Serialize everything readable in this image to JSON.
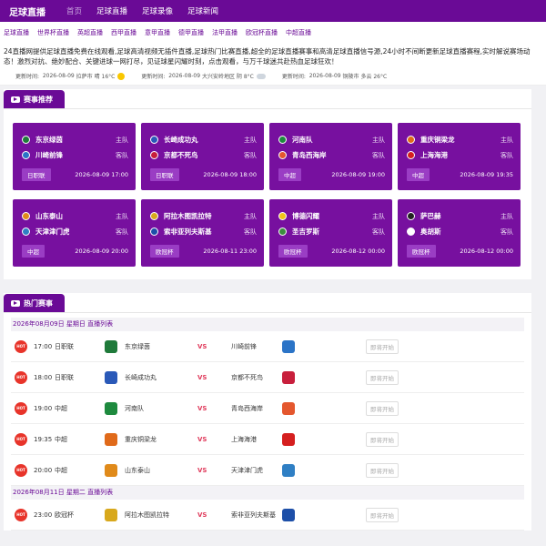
{
  "header": {
    "logo": "足球直播",
    "nav": [
      "首页",
      "足球直播",
      "足球录像",
      "足球新闻"
    ]
  },
  "subnav": [
    "足球直播",
    "世界杯直播",
    "英超直播",
    "西甲直播",
    "意甲直播",
    "德甲直播",
    "法甲直播",
    "欧冠杯直播",
    "中超直播"
  ],
  "intro": "24直播网提供足球直播免费在线观看,足球高清视频无插件直播,足球热门比赛直播,超全的足球直播赛事和高清足球直播信号源,24小时不间断更新足球直播赛程,实时解说赛场动态！激烈对抗、绝妙配合、关键进球一网打尽，见证球星闪耀时刻，点击观看，与万千球迷共赴热血足球狂欢！",
  "weather": [
    {
      "label": "更新时间:",
      "date": "2026-08-09",
      "place": "拉萨市",
      "cond": "晴 16°C",
      "icon": "sun-icon"
    },
    {
      "label": "更新时间:",
      "date": "2026-08-09",
      "place": "大兴安岭地区",
      "cond": "阴 8°C",
      "icon": "cloud-icon"
    },
    {
      "label": "更新时间:",
      "date": "2026-08-09",
      "place": "铜陵市",
      "cond": "多云 26°C",
      "icon": ""
    }
  ],
  "recommend": {
    "title": "赛事推荐",
    "home_label": "主队",
    "away_label": "客队",
    "cards": [
      {
        "home": "东京绿茵",
        "away": "川崎前锋",
        "league": "日职联",
        "time": "2026-08-09 17:00",
        "hc": "#1f7a3a",
        "ac": "#2b74c7"
      },
      {
        "home": "长崎成功丸",
        "away": "京都不死鸟",
        "league": "日职联",
        "time": "2026-08-09 18:00",
        "hc": "#2a59b8",
        "ac": "#c81f3c"
      },
      {
        "home": "河南队",
        "away": "青岛西海岸",
        "league": "中超",
        "time": "2026-08-09 19:00",
        "hc": "#1e8a3e",
        "ac": "#e4572e"
      },
      {
        "home": "重庆铜梁龙",
        "away": "上海海港",
        "league": "中超",
        "time": "2026-08-09 19:35",
        "hc": "#e06a1a",
        "ac": "#d51f1f"
      },
      {
        "home": "山东泰山",
        "away": "天津津门虎",
        "league": "中超",
        "time": "2026-08-09 20:00",
        "hc": "#e08a1a",
        "ac": "#2f7fc4"
      },
      {
        "home": "阿拉木图凯拉特",
        "away": "索非亚列夫斯基",
        "league": "欧冠杯",
        "time": "2026-08-11 23:00",
        "hc": "#d8a81c",
        "ac": "#1d4fa8"
      },
      {
        "home": "博德闪耀",
        "away": "圣吉罗斯",
        "league": "欧冠杯",
        "time": "2026-08-12 00:00",
        "hc": "#f0c419",
        "ac": "#3c8d3f"
      },
      {
        "home": "萨巴赫",
        "away": "奥胡斯",
        "league": "欧冠杯",
        "time": "2026-08-12 00:00",
        "hc": "#222222",
        "ac": "#ffffff"
      }
    ]
  },
  "hot": {
    "title": "热门赛事",
    "days": [
      {
        "date": "2026年08月09日 星期日 直播列表",
        "matches": [
          {
            "time": "17:00",
            "league": "日职联",
            "home": "东京绿茵",
            "away": "川崎前锋",
            "vs": "VS",
            "btn": "即将开始",
            "hc": "#1f7a3a",
            "ac": "#2b74c7"
          },
          {
            "time": "18:00",
            "league": "日职联",
            "home": "长崎成功丸",
            "away": "京都不死鸟",
            "vs": "VS",
            "btn": "即将开始",
            "hc": "#2a59b8",
            "ac": "#c81f3c"
          },
          {
            "time": "19:00",
            "league": "中超",
            "home": "河南队",
            "away": "青岛西海岸",
            "vs": "VS",
            "btn": "即将开始",
            "hc": "#1e8a3e",
            "ac": "#e4572e"
          },
          {
            "time": "19:35",
            "league": "中超",
            "home": "重庆铜梁龙",
            "away": "上海海港",
            "vs": "VS",
            "btn": "即将开始",
            "hc": "#e06a1a",
            "ac": "#d51f1f"
          },
          {
            "time": "20:00",
            "league": "中超",
            "home": "山东泰山",
            "away": "天津津门虎",
            "vs": "VS",
            "btn": "即将开始",
            "hc": "#e08a1a",
            "ac": "#2f7fc4"
          }
        ]
      },
      {
        "date": "2026年08月11日 星期二 直播列表",
        "matches": [
          {
            "time": "23:00",
            "league": "欧冠杯",
            "home": "阿拉木图凯拉特",
            "away": "索非亚列夫斯基",
            "vs": "VS",
            "btn": "即将开始",
            "hc": "#d8a81c",
            "ac": "#1d4fa8"
          }
        ]
      }
    ],
    "hot_icon_text": "HOT"
  },
  "colors": {
    "brand": "#6a0a96",
    "card": "#77109f",
    "vs": "#e03b5c"
  }
}
